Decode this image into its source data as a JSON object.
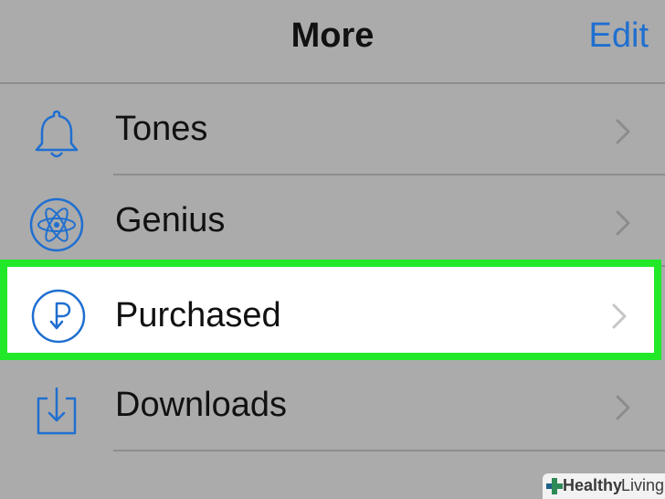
{
  "nav": {
    "title": "More",
    "edit_label": "Edit"
  },
  "rows": [
    {
      "label": "Tones",
      "icon": "bell-icon"
    },
    {
      "label": "Genius",
      "icon": "atom-icon"
    },
    {
      "label": "Purchased",
      "icon": "purchased-icon",
      "highlighted": true
    },
    {
      "label": "Downloads",
      "icon": "download-tray-icon"
    }
  ],
  "watermark": {
    "brand_bold": "Healthy",
    "brand_light": "Living"
  },
  "colors": {
    "background": "#ababab",
    "accent_blue": "#1f6fd0",
    "highlight_green": "#22e82a",
    "separator": "#8e8e8e",
    "highlighted_row_bg": "#ffffff"
  }
}
